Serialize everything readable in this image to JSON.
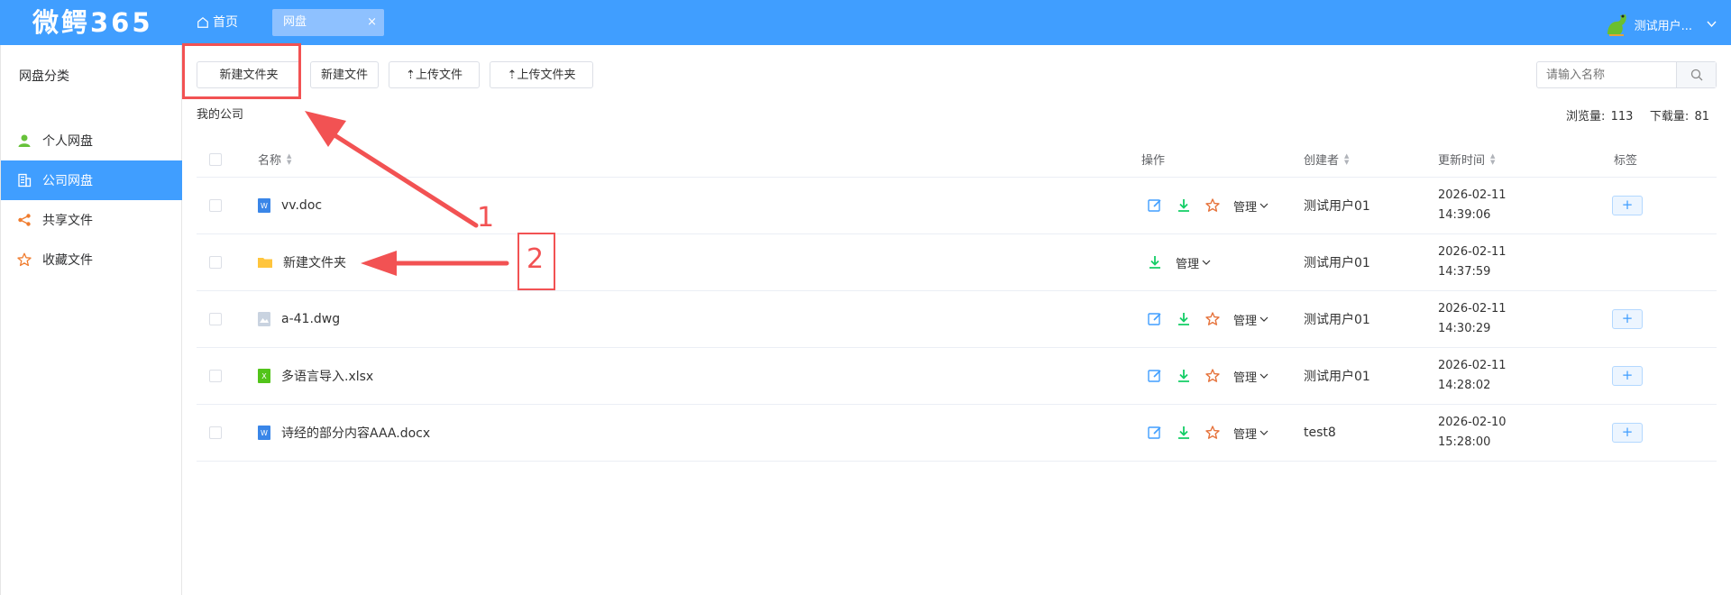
{
  "app": {
    "logo": "微鳄365"
  },
  "tabs": {
    "home": "首页",
    "active": "网盘",
    "close": "×"
  },
  "user": {
    "name": "测试用户..."
  },
  "sidebar": {
    "title": "网盘分类",
    "items": [
      {
        "label": "个人网盘",
        "icon": "user-icon",
        "active": false
      },
      {
        "label": "公司网盘",
        "icon": "building-icon",
        "active": true
      },
      {
        "label": "共享文件",
        "icon": "share-icon",
        "active": false
      },
      {
        "label": "收藏文件",
        "icon": "star-icon",
        "active": false
      }
    ]
  },
  "toolbar": {
    "new_folder": "新建文件夹",
    "new_file": "新建文件",
    "upload_file": "⇡上传文件",
    "upload_folder": "⇡上传文件夹"
  },
  "search": {
    "placeholder": "请输入名称"
  },
  "breadcrumb": "我的公司",
  "stats": {
    "views_label": "浏览量:",
    "views": "113",
    "downloads_label": "下载量:",
    "downloads": "81"
  },
  "table": {
    "headers": {
      "name": "名称",
      "ops": "操作",
      "creator": "创建者",
      "updated": "更新时间",
      "tags": "标签"
    },
    "manage_label": "管理",
    "tag_add": "+",
    "rows": [
      {
        "name": "vv.doc",
        "type": "word",
        "creator": "测试用户01",
        "date": "2026-02-11",
        "time": "14:39:06",
        "full_ops": true
      },
      {
        "name": "新建文件夹",
        "type": "folder",
        "creator": "测试用户01",
        "date": "2026-02-11",
        "time": "14:37:59",
        "full_ops": false
      },
      {
        "name": "a-41.dwg",
        "type": "image",
        "creator": "测试用户01",
        "date": "2026-02-11",
        "time": "14:30:29",
        "full_ops": true
      },
      {
        "name": "多语言导入.xlsx",
        "type": "excel",
        "creator": "测试用户01",
        "date": "2026-02-11",
        "time": "14:28:02",
        "full_ops": true
      },
      {
        "name": "诗经的部分内容AAA.docx",
        "type": "word",
        "creator": "test8",
        "date": "2026-02-10",
        "time": "15:28:00",
        "full_ops": true
      }
    ]
  },
  "annotations": {
    "label1": "1",
    "label2": "2"
  },
  "colors": {
    "primary": "#409eff",
    "download": "#13ce66",
    "star": "#e6733c",
    "annotation": "#f25253"
  }
}
